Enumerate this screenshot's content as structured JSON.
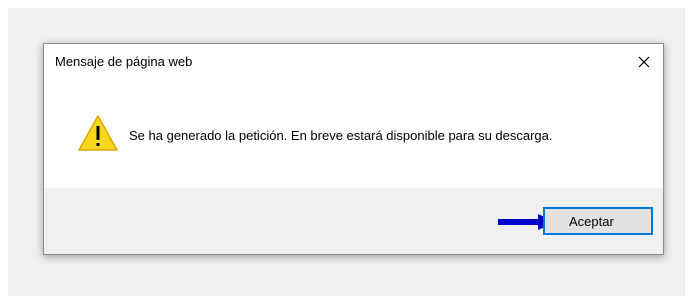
{
  "dialog": {
    "title": "Mensaje de página web",
    "close_icon": "close-icon",
    "message": "Se ha generado la petición. En breve estará disponible para su descarga.",
    "warning_icon": "warning-icon",
    "ok_label": "Aceptar",
    "annotation_icon": "arrow-right-icon"
  },
  "colors": {
    "accent": "#0078d7",
    "warning": "#f9d71c",
    "annotation_arrow": "#0000cc",
    "footer": "#f0f0f0"
  }
}
